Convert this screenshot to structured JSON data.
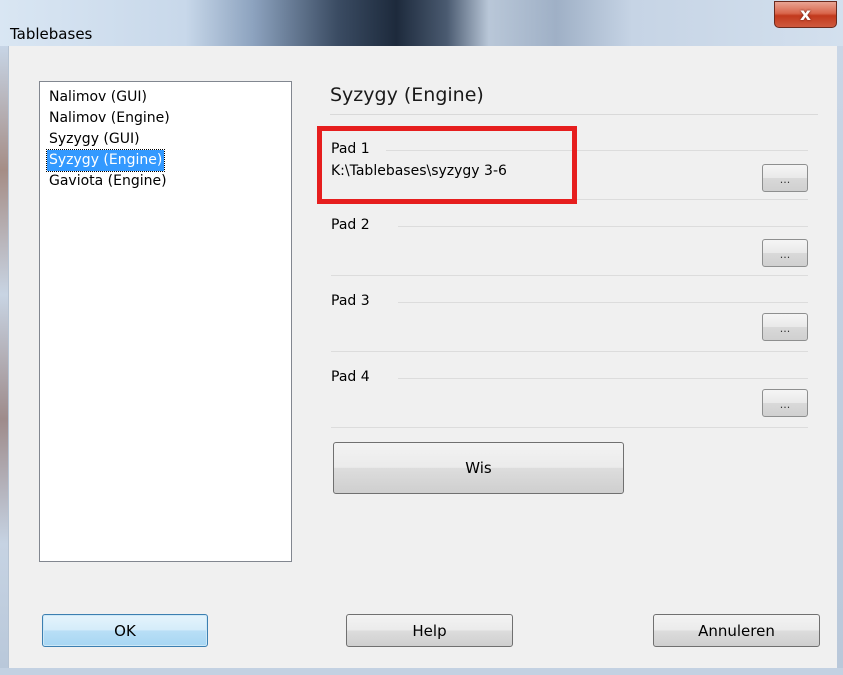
{
  "window": {
    "title": "Tablebases",
    "close_glyph": "x"
  },
  "sidebar": {
    "items": [
      {
        "label": "Nalimov (GUI)",
        "selected": false
      },
      {
        "label": "Nalimov (Engine)",
        "selected": false
      },
      {
        "label": "Syzygy (GUI)",
        "selected": false
      },
      {
        "label": "Syzygy (Engine)",
        "selected": true
      },
      {
        "label": "Gaviota (Engine)",
        "selected": false
      }
    ]
  },
  "panel": {
    "title": "Syzygy (Engine)",
    "paths": [
      {
        "label": "Pad 1",
        "value": "K:\\Tablebases\\syzygy 3-6",
        "browse_label": "..."
      },
      {
        "label": "Pad 2",
        "value": "",
        "browse_label": "..."
      },
      {
        "label": "Pad 3",
        "value": "",
        "browse_label": "..."
      },
      {
        "label": "Pad 4",
        "value": "",
        "browse_label": "..."
      }
    ],
    "clear_label": "Wis"
  },
  "footer": {
    "ok_label": "OK",
    "help_label": "Help",
    "cancel_label": "Annuleren"
  },
  "colors": {
    "selection": "#3399ff",
    "annotation_box": "#e61e1e",
    "close_button": "#c2391d"
  }
}
